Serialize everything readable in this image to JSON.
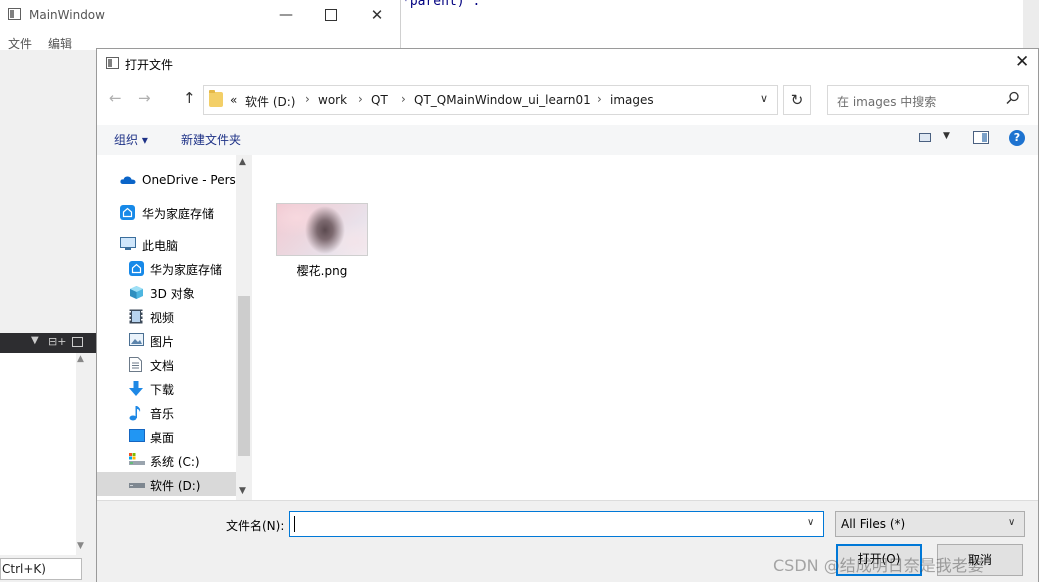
{
  "code_editor": {
    "line_fragment": "*parent) ."
  },
  "main_window": {
    "title": "MainWindow",
    "minimize_glyph": "—",
    "close_glyph": "✕",
    "menu": [
      "文件",
      "编辑"
    ]
  },
  "dock": {
    "dropdown_glyph": "▼",
    "split_glyph": "⊟+",
    "shortcut_text": "Ctrl+K)"
  },
  "dialog": {
    "title": "打开文件",
    "close_glyph": "✕",
    "nav": {
      "back": "←",
      "forward": "→",
      "up": "↑",
      "refresh": "↻"
    },
    "breadcrumb": {
      "overflow": "«",
      "separator": "›",
      "items": [
        "软件 (D:)",
        "work",
        "QT",
        "QT_QMainWindow_ui_learn01",
        "images"
      ]
    },
    "search": {
      "placeholder": "在 images 中搜索",
      "icon": "search-icon"
    },
    "toolbar": {
      "organize_label": "组织 ▾",
      "new_folder_label": "新建文件夹",
      "view_dropdown": "▼",
      "help_label": "?"
    },
    "nav_pane": {
      "items": [
        {
          "label": "OneDrive - Perso",
          "icon": "cloud-icon"
        },
        {
          "label": "华为家庭存储",
          "icon": "huawei-storage-icon"
        },
        {
          "label": "此电脑",
          "icon": "computer-icon"
        },
        {
          "label": "华为家庭存储",
          "icon": "huawei-storage-icon"
        },
        {
          "label": "3D 对象",
          "icon": "cube-icon"
        },
        {
          "label": "视频",
          "icon": "video-icon"
        },
        {
          "label": "图片",
          "icon": "picture-icon"
        },
        {
          "label": "文档",
          "icon": "document-icon"
        },
        {
          "label": "下载",
          "icon": "download-icon"
        },
        {
          "label": "音乐",
          "icon": "music-icon"
        },
        {
          "label": "桌面",
          "icon": "desktop-icon"
        },
        {
          "label": "系统 (C:)",
          "icon": "drive-icon"
        },
        {
          "label": "软件 (D:)",
          "icon": "drive-icon"
        }
      ],
      "scroll_up": "▲",
      "scroll_down": "▼"
    },
    "files": [
      {
        "name": "樱花.png",
        "type": "image"
      }
    ],
    "bottom": {
      "filename_label": "文件名(N):",
      "filename_value": "",
      "filetype_value": "All Files  (*)",
      "dropdown_glyph": "▾",
      "open_label": "打开(O)",
      "cancel_label": "取消"
    }
  },
  "watermark": "CSDN @结成明日奈是我老婆",
  "colors": {
    "accent": "#0078d7",
    "selection": "#cce8ff",
    "link_blue": "#1e3287",
    "folder_yellow": "#f3cf67",
    "dock_dark": "#2d2d30"
  }
}
